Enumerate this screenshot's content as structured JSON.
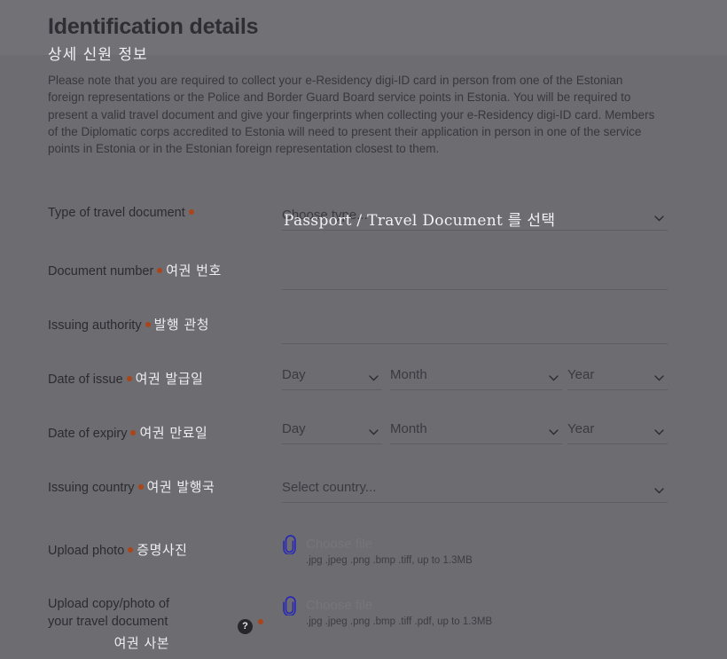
{
  "header": {
    "title": "Identification details",
    "title_kr": "상세 신원 정보",
    "intro": "Please note that you are required to collect your e-Residency digi-ID card in person from one of the Estonian foreign representations or the Police and Border Guard Board service points in Estonia. You will be required to present a valid travel document and give your fingerprints when collecting your e-Residency digi-ID card. Members of the Diplomatic corps accredited to Estonia will need to present their application in person in one of the service points in Estonia or in the Estonian foreign representation closest to them."
  },
  "colors": {
    "background": "#6c6c71",
    "required_dot": "#ab4419",
    "clip_icon": "#2a2ab4",
    "annotation_text": "#f2f2f4",
    "label_text": "#2b2b30"
  },
  "form": {
    "travel_document_type": {
      "label": "Type of travel document",
      "required_marker": "•",
      "placeholder": "Choose type...",
      "value": "",
      "annotation_kr": "Passport / Travel Document 를 선택",
      "chevron_icon": "chevron-down-icon"
    },
    "document_number": {
      "label": "Document number",
      "required_marker": "•",
      "label_kr": "여권 번호",
      "value": "",
      "placeholder": ""
    },
    "issuing_authority": {
      "label": "Issuing authority",
      "required_marker": "•",
      "label_kr": "발행 관청",
      "value": "",
      "placeholder": ""
    },
    "date_of_issue": {
      "label": "Date of issue",
      "required_marker": "•",
      "label_kr": "여권 발급일",
      "day": "Day",
      "month": "Month",
      "year": "Year",
      "chevron_icon": "chevron-down-icon"
    },
    "date_of_expiry": {
      "label": "Date of expiry",
      "required_marker": "•",
      "label_kr": "여권 만료일",
      "day": "Day",
      "month": "Month",
      "year": "Year",
      "chevron_icon": "chevron-down-icon"
    },
    "issuing_country": {
      "label": "Issuing country",
      "required_marker": "•",
      "label_kr": "여권 발행국",
      "placeholder": "Select country...",
      "value": "",
      "chevron_icon": "chevron-down-icon"
    },
    "upload_photo": {
      "label": "Upload photo",
      "required_marker": "•",
      "label_kr": "증명사진",
      "choose_file": "Choose file",
      "hint": ".jpg .jpeg .png .bmp .tiff, up to 1.3MB",
      "clip_icon": "paperclip-icon"
    },
    "upload_travel_document": {
      "label_line1": "Upload copy/photo of",
      "label_line2": "your travel document",
      "required_marker": "•",
      "help_marker": "?",
      "label_kr": "여권 사본",
      "choose_file": "Choose file",
      "hint": ".jpg .jpeg .png .bmp .tiff .pdf, up to 1.3MB",
      "clip_icon": "paperclip-icon",
      "help_icon": "question-mark-icon"
    }
  }
}
